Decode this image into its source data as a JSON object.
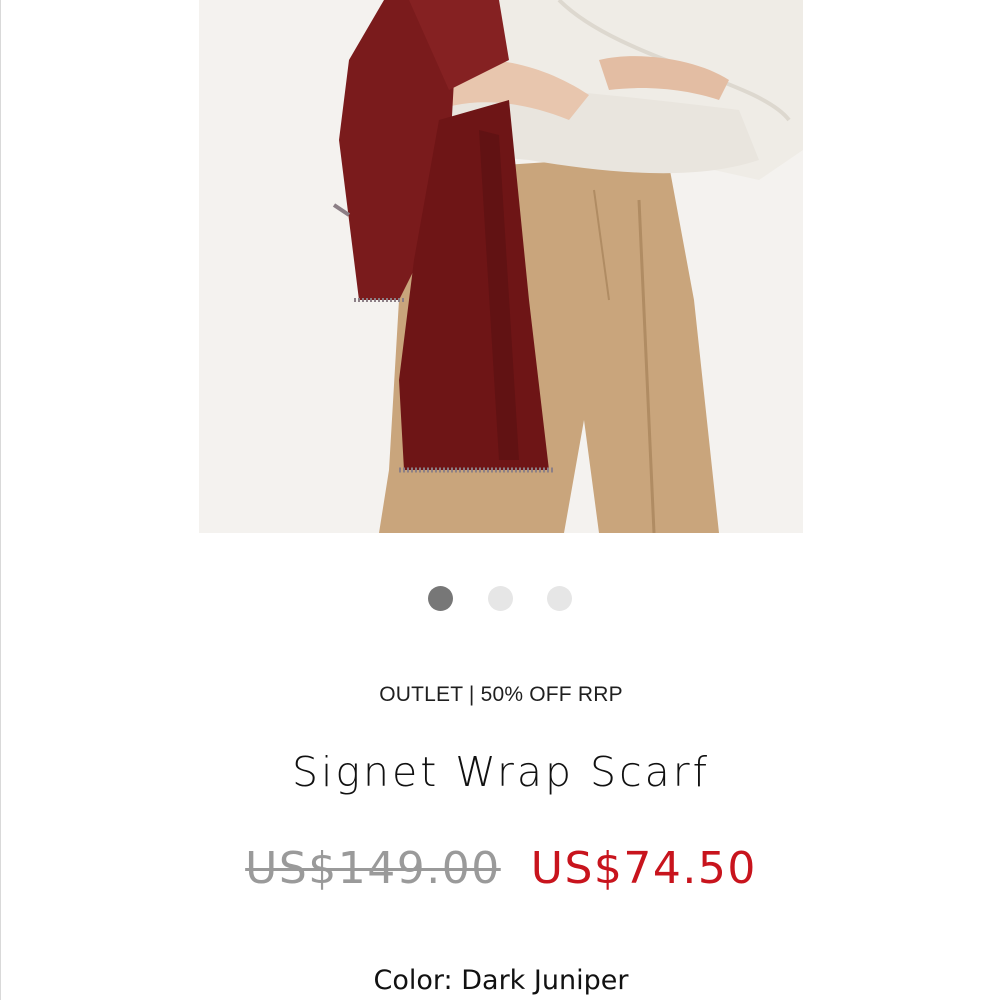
{
  "product": {
    "image_alt": "Model wearing red scarf with white blouse and beige trousers",
    "eyebrow": "OUTLET | 50% OFF RRP",
    "title": "Signet Wrap Scarf",
    "price_original": "US$149.00",
    "price_sale": "US$74.50",
    "color_label": "Color:",
    "color_value": "Dark Juniper"
  },
  "carousel": {
    "total_slides": 3,
    "active_index": 0
  },
  "colors": {
    "sale_price": "#c8141d",
    "original_price": "#9a9a9a",
    "dot_active": "#777777",
    "dot_inactive": "#e6e6e6",
    "scarf": "#7a1b1c"
  }
}
